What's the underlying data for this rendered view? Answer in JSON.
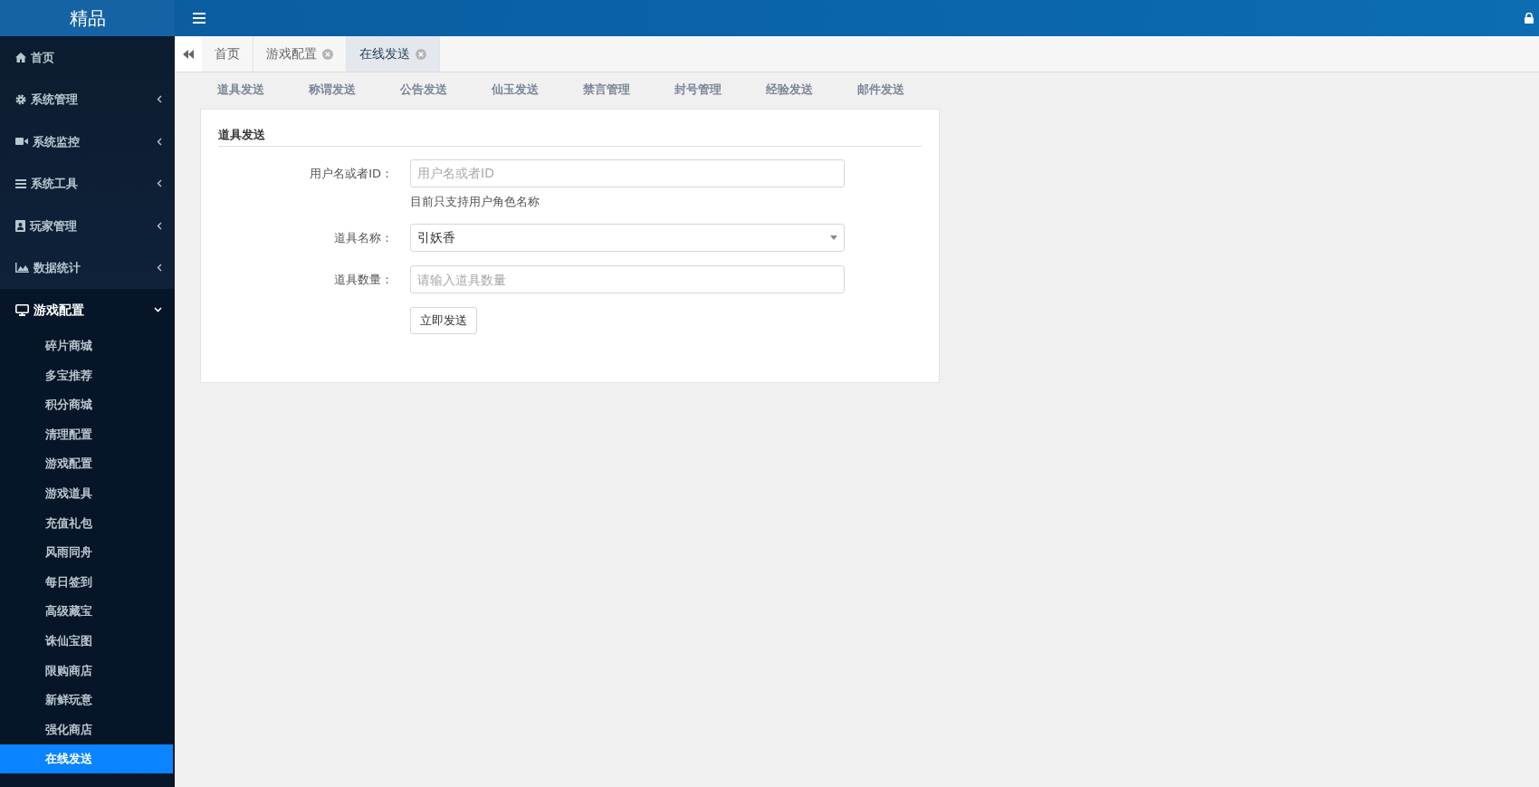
{
  "brand": "精品",
  "sidebar": {
    "items": [
      {
        "label": "首页"
      },
      {
        "label": "系统管理",
        "expanded": false
      },
      {
        "label": "系统监控",
        "expanded": false
      },
      {
        "label": "系统工具",
        "expanded": false
      },
      {
        "label": "玩家管理",
        "expanded": false
      },
      {
        "label": "数据统计",
        "expanded": false
      },
      {
        "label": "游戏配置",
        "expanded": true,
        "children": [
          {
            "label": "碎片商城",
            "selected": false
          },
          {
            "label": "多宝推荐",
            "selected": false
          },
          {
            "label": "积分商城",
            "selected": false
          },
          {
            "label": "清理配置",
            "selected": false
          },
          {
            "label": "游戏配置",
            "selected": false
          },
          {
            "label": "游戏道具",
            "selected": false
          },
          {
            "label": "充值礼包",
            "selected": false
          },
          {
            "label": "风雨同舟",
            "selected": false
          },
          {
            "label": "每日签到",
            "selected": false
          },
          {
            "label": "高级藏宝",
            "selected": false
          },
          {
            "label": "诛仙宝图",
            "selected": false
          },
          {
            "label": "限购商店",
            "selected": false
          },
          {
            "label": "新鲜玩意",
            "selected": false
          },
          {
            "label": "强化商店",
            "selected": false
          },
          {
            "label": "在线发送",
            "selected": true
          }
        ]
      }
    ]
  },
  "tabs": [
    {
      "label": "首页",
      "closable": false,
      "selected": false
    },
    {
      "label": "游戏配置",
      "closable": true,
      "selected": false
    },
    {
      "label": "在线发送",
      "closable": true,
      "selected": true
    }
  ],
  "subnav": [
    "道具发送",
    "称谓发送",
    "公告发送",
    "仙玉发送",
    "禁言管理",
    "封号管理",
    "经验发送",
    "邮件发送"
  ],
  "form": {
    "title": "道具发送",
    "fields": [
      {
        "kind": "text",
        "label": "用户名或者ID：",
        "placeholder": "用户名或者ID",
        "help": "目前只支持用户角色名称"
      },
      {
        "kind": "select",
        "label": "道具名称：",
        "value": "引妖香"
      },
      {
        "kind": "text",
        "label": "道具数量：",
        "placeholder": "请输入道具数量"
      }
    ],
    "submit": "立即发送"
  }
}
